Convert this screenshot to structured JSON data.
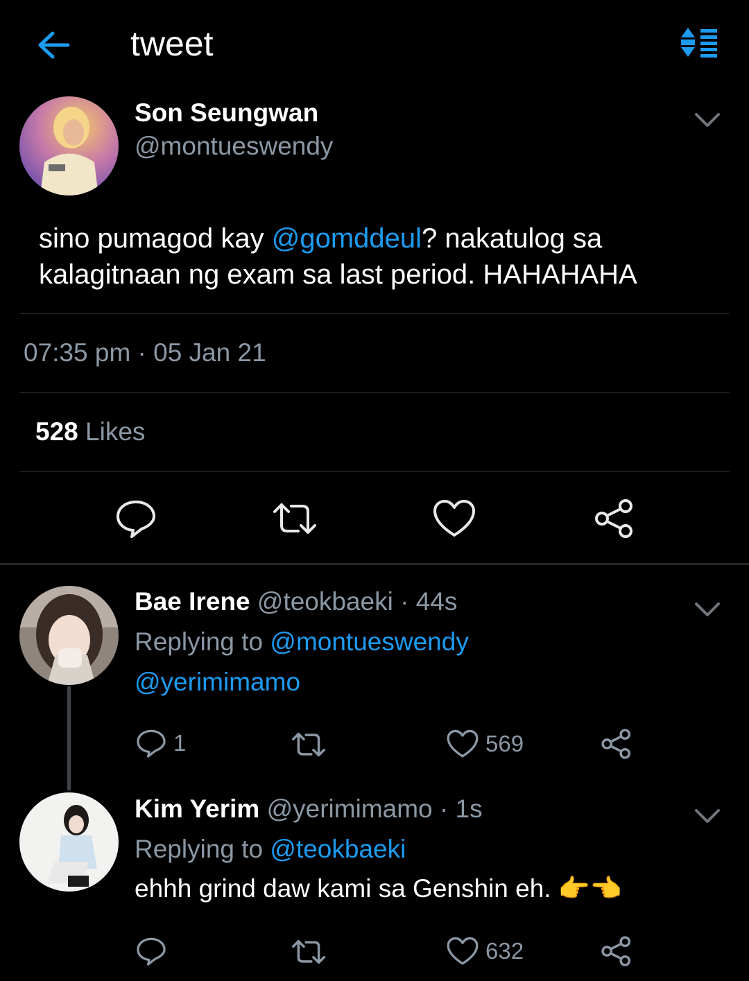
{
  "header": {
    "title": "tweet",
    "back_icon": "arrow-left-icon",
    "sort_icon": "sort-icon",
    "accent": "#1d9bf0"
  },
  "main_tweet": {
    "name": "Son Seungwan",
    "handle": "@montueswendy",
    "text_pre": "sino pumagod kay ",
    "mention": "@gomddeul",
    "text_post": "? nakatulog sa kalagitnaan ng exam sa last period. HAHAHAHA",
    "timestamp": "07:35 pm · 05 Jan 21",
    "likes_count": "528",
    "likes_label": "Likes"
  },
  "replies": [
    {
      "name": "Bae Irene",
      "meta": "@teokbaeki · 44s",
      "replying_label": "Replying to",
      "replying_to": "@montueswendy",
      "body_mention": "@yerimimamo",
      "reply_count": "1",
      "like_count": "569"
    },
    {
      "name": "Kim Yerim",
      "meta": "@yerimimamo · 1s",
      "replying_label": "Replying to",
      "replying_to": "@teokbaeki",
      "body": "ehhh grind daw kami sa Genshin eh. 👉👈",
      "like_count": "632"
    }
  ],
  "colors": {
    "background": "#000000",
    "secondary_text": "#8b98a5",
    "link": "#1d9bf0",
    "icon": "#e7e9ea"
  }
}
